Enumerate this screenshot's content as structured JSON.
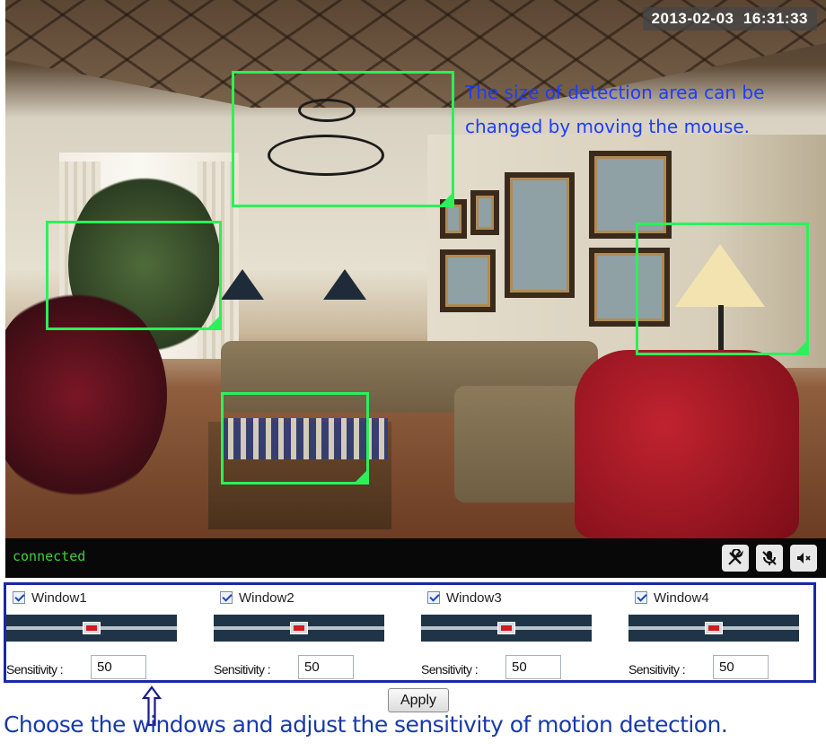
{
  "camera": {
    "timestamp": "2013-02-03  16:31:33",
    "status": "connected",
    "annotation": "The size of detection area can be changed by moving the mouse."
  },
  "controls": {
    "settings_icon": "tools-icon",
    "mic_icon": "mic-mute-icon",
    "speaker_icon": "speaker-mute-icon"
  },
  "windows": [
    {
      "label": "Window1",
      "checked": true,
      "sensitivity_label": "Sensitivity :",
      "sensitivity": "50",
      "slider_level": 0.5
    },
    {
      "label": "Window2",
      "checked": true,
      "sensitivity_label": "Sensitivity :",
      "sensitivity": "50",
      "slider_level": 0.5
    },
    {
      "label": "Window3",
      "checked": true,
      "sensitivity_label": "Sensitivity :",
      "sensitivity": "50",
      "slider_level": 0.5
    },
    {
      "label": "Window4",
      "checked": true,
      "sensitivity_label": "Sensitivity :",
      "sensitivity": "50",
      "slider_level": 0.5
    }
  ],
  "apply_label": "Apply",
  "annotation_bottom": "Choose the windows and adjust the sensitivity of motion detection.",
  "colors": {
    "detection_box": "#2cf05a",
    "panel_border": "#1828a8",
    "annotation_text": "#1b3dff",
    "status_text": "#3bd13b"
  }
}
